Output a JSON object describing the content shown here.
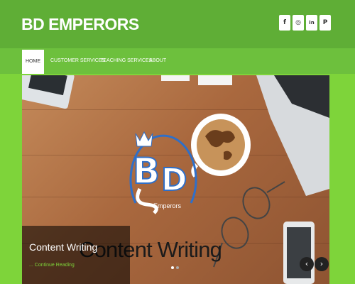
{
  "site": {
    "title": "BD EMPERORS"
  },
  "social": [
    {
      "name": "facebook",
      "glyph": "f"
    },
    {
      "name": "instagram",
      "glyph": "◎"
    },
    {
      "name": "linkedin",
      "glyph": "in"
    },
    {
      "name": "pinterest",
      "glyph": "P"
    }
  ],
  "nav": {
    "items": [
      {
        "label": "HOME",
        "active": true
      },
      {
        "label": "CUSTOMER SERVICES",
        "active": false
      },
      {
        "label": "TEACHING SERVICES",
        "active": false
      },
      {
        "label": "ABOUT",
        "active": false
      }
    ]
  },
  "slider": {
    "logo_text": "Emperors",
    "caption_title": "Content Writing",
    "caption_link": "... Continue Reading",
    "overlay_text": "Content Writing",
    "prev_glyph": "‹",
    "next_glyph": "›",
    "slide_count": 2,
    "active_slide": 1
  },
  "colors": {
    "header": "#5fae36",
    "nav": "#6dc03d",
    "page_bg": "#7ed43a",
    "link": "#7ed43a"
  }
}
